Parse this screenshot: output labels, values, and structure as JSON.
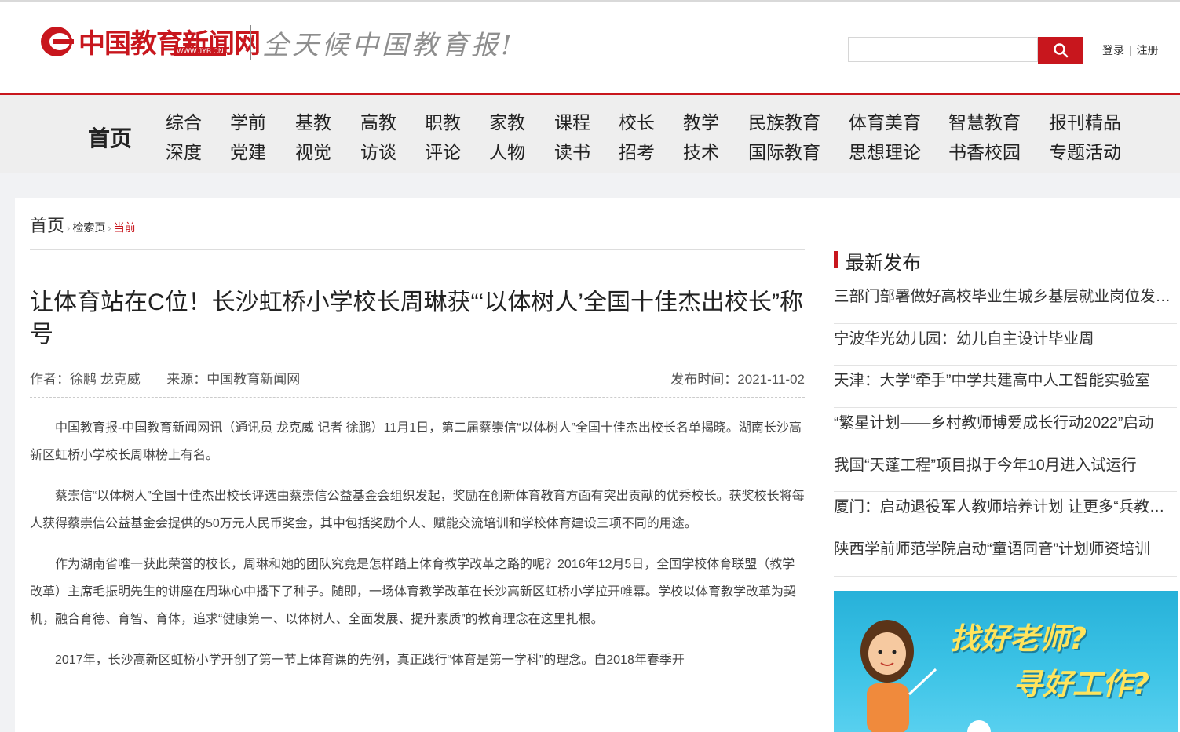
{
  "header": {
    "logo_text": "中国教育新闻网",
    "logo_url": "WWW.JYB.CN",
    "slogan": "全天候中国教育报!",
    "search_placeholder": "",
    "login": "登录",
    "separator": "|",
    "register": "注册"
  },
  "nav": {
    "home": "首页",
    "columns": [
      [
        "综合",
        "深度"
      ],
      [
        "学前",
        "党建"
      ],
      [
        "基教",
        "视觉"
      ],
      [
        "高教",
        "访谈"
      ],
      [
        "职教",
        "评论"
      ],
      [
        "家教",
        "人物"
      ],
      [
        "课程",
        "读书"
      ],
      [
        "校长",
        "招考"
      ],
      [
        "教学",
        "技术"
      ],
      [
        "民族教育",
        "国际教育"
      ],
      [
        "体育美育",
        "思想理论"
      ],
      [
        "智慧教育",
        "书香校园"
      ],
      [
        "报刊精品",
        "专题活动"
      ]
    ]
  },
  "breadcrumb": {
    "home": "首页",
    "mid": "检索页",
    "current": "当前"
  },
  "article": {
    "title": "让体育站在C位！长沙虹桥小学校长周琳获“‘以体树人’全国十佳杰出校长”称号",
    "author": "作者：徐鹏 龙克威",
    "source": "来源：中国教育新闻网",
    "date": "发布时间：2021-11-02",
    "paragraphs": [
      "中国教育报-中国教育新闻网讯（通讯员 龙克威 记者 徐鹏）11月1日，第二届蔡崇信“以体树人”全国十佳杰出校长名单揭晓。湖南长沙高新区虹桥小学校长周琳榜上有名。",
      "蔡崇信“以体树人”全国十佳杰出校长评选由蔡崇信公益基金会组织发起，奖励在创新体育教育方面有突出贡献的优秀校长。获奖校长将每人获得蔡崇信公益基金会提供的50万元人民币奖金，其中包括奖励个人、赋能交流培训和学校体育建设三项不同的用途。",
      "作为湖南省唯一获此荣誉的校长，周琳和她的团队究竟是怎样踏上体育教学改革之路的呢？2016年12月5日，全国学校体育联盟（教学改革）主席毛振明先生的讲座在周琳心中播下了种子。随即，一场体育教学改革在长沙高新区虹桥小学拉开帷幕。学校以体育教学改革为契机，融合育德、育智、育体，追求“健康第一、以体树人、全面发展、提升素质”的教育理念在这里扎根。",
      "2017年，长沙高新区虹桥小学开创了第一节上体育课的先例，真正践行“体育是第一学科”的理念。自2018年春季开"
    ]
  },
  "sidebar": {
    "title": "最新发布",
    "items": [
      "三部门部署做好高校毕业生城乡基层就业岗位发布工作",
      "宁波华光幼儿园：幼儿自主设计毕业周",
      "天津：大学“牵手”中学共建高中人工智能实验室",
      "“繁星计划——乡村教师博爱成长行动2022”启动",
      "我国“天蓬工程”项目拟于今年10月进入试运行",
      "厦门：启动退役军人教师培养计划 让更多“兵教师”走上讲台",
      "陕西学前师范学院启动“童语同音”计划师资培训"
    ],
    "ad_line1": "找好老师?",
    "ad_line2": "寻好工作?"
  },
  "colors": {
    "brand_red": "#c8161d",
    "nav_bg": "#eeeeee",
    "page_bg": "#f1f2f4",
    "ad_blue": "#3cc3e6",
    "ad_yellow": "#ffe45c"
  }
}
